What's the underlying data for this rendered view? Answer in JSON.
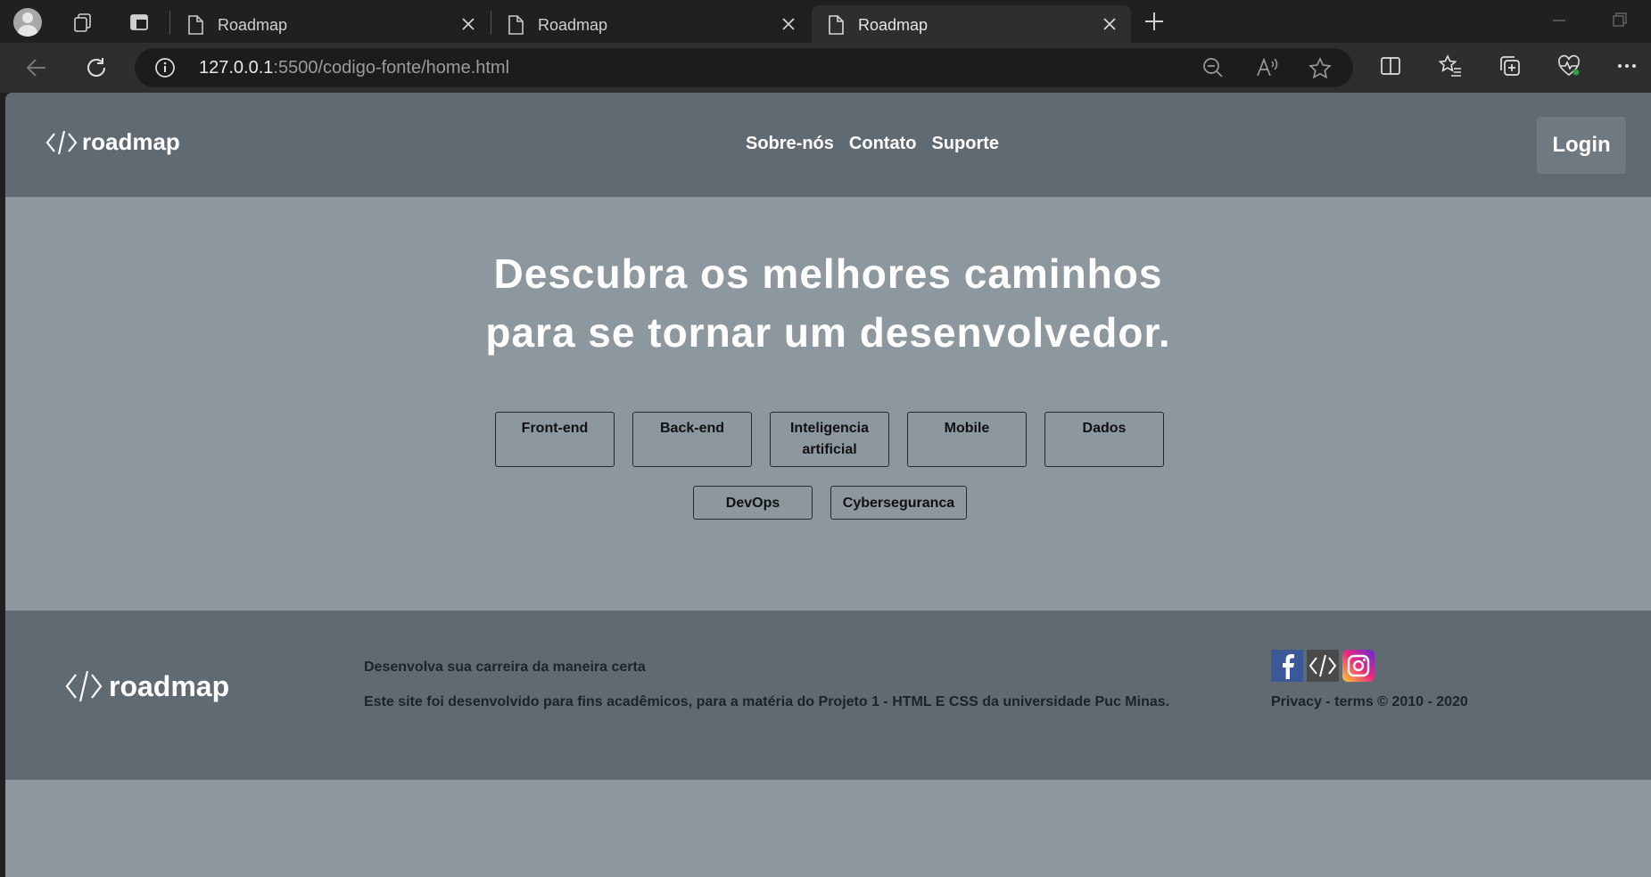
{
  "browser": {
    "tabs": [
      {
        "title": "Roadmap",
        "active": false
      },
      {
        "title": "Roadmap",
        "active": false
      },
      {
        "title": "Roadmap",
        "active": true
      }
    ],
    "url": {
      "host": "127.0.0.1",
      "rest": ":5500/codigo-fonte/home.html"
    },
    "icons": [
      "profile-avatar-icon",
      "workspaces-icon",
      "tab-actions-icon",
      "page-icon",
      "close-icon",
      "new-tab-icon",
      "back-icon",
      "refresh-icon",
      "info-icon",
      "zoom-out-icon",
      "read-aloud-icon",
      "favorite-star-icon",
      "split-screen-icon",
      "favorites-icon",
      "collections-icon",
      "browser-essentials-icon",
      "more-icon"
    ]
  },
  "site": {
    "header": {
      "logo": "roadmap",
      "nav": [
        "Sobre-nós",
        "Contato",
        "Suporte"
      ],
      "login": "Login"
    },
    "hero": {
      "line1": "Descubra os melhores caminhos",
      "line2": "para se tornar um desenvolvedor."
    },
    "paths_row1": [
      {
        "line1": "Front-end",
        "line2": ""
      },
      {
        "line1": "Back-end",
        "line2": ""
      },
      {
        "line1": "Inteligencia",
        "line2": "artificial"
      },
      {
        "line1": "Mobile",
        "line2": ""
      },
      {
        "line1": "Dados",
        "line2": ""
      }
    ],
    "paths_row2": [
      "DevOps",
      "Cyberseguranca"
    ],
    "footer": {
      "logo": "roadmap",
      "tagline": "Desenvolva sua carreira da maneira certa",
      "description": "Este site foi desenvolvido para fins acadêmicos, para a matéria do Projeto 1 - HTML E CSS da universidade Puc Minas.",
      "social": [
        "facebook-icon",
        "roadmap-icon",
        "instagram-icon"
      ],
      "legal": "Privacy - terms © 2010 - 2020"
    }
  }
}
